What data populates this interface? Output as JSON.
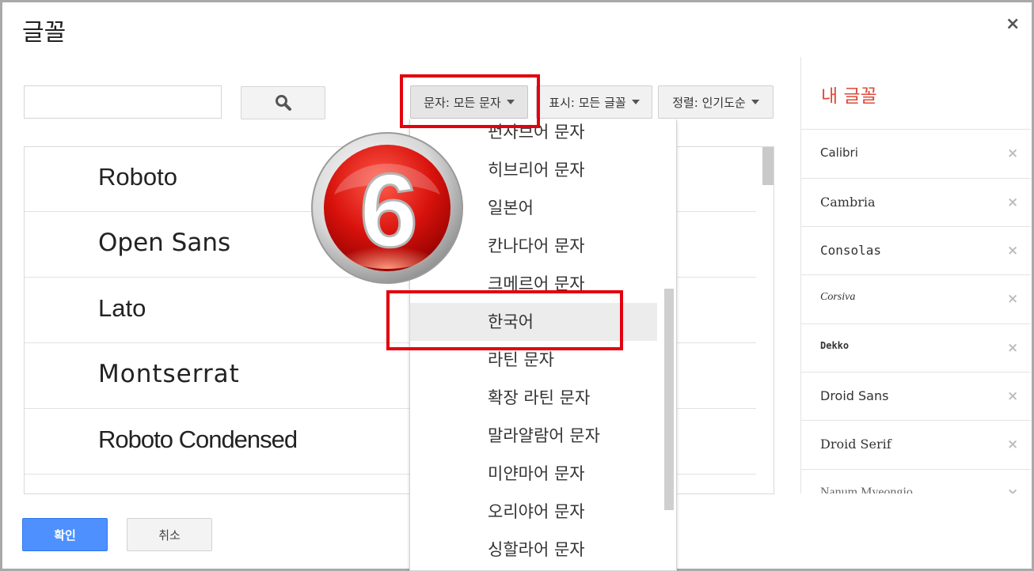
{
  "dialog": {
    "title": "글꼴",
    "close_glyph": "×"
  },
  "toolbar": {
    "search_placeholder": "",
    "search_icon": "search-icon",
    "script_filter": "문자: 모든 문자",
    "display_filter": "표시: 모든 글꼴",
    "sort_filter": "정렬: 인기도순"
  },
  "font_list": [
    "Roboto",
    "Open Sans",
    "Lato",
    "Montserrat",
    "Roboto Condensed"
  ],
  "script_menu": {
    "items": [
      "펀자브어 문자",
      "히브리어 문자",
      "일본어",
      "칸나다어 문자",
      "크메르어 문자",
      "한국어",
      "라틴 문자",
      "확장 라틴 문자",
      "말라얄람어 문자",
      "미얀마어 문자",
      "오리야어 문자",
      "싱할라어 문자"
    ],
    "selected": "한국어"
  },
  "my_fonts": {
    "title": "내 글꼴",
    "items": [
      "Calibri",
      "Cambria",
      "Consolas",
      "Corsiva",
      "Dekko",
      "Droid Sans",
      "Droid Serif",
      "Nanum Myeongjo"
    ],
    "remove_glyph": "×"
  },
  "footer": {
    "ok_label": "확인",
    "cancel_label": "취소"
  },
  "annotation": {
    "step_number": "6",
    "highlight_color": "#e3000f"
  },
  "colors": {
    "accent_blue": "#4d90fe",
    "my_fonts_title": "#dd4b39"
  }
}
